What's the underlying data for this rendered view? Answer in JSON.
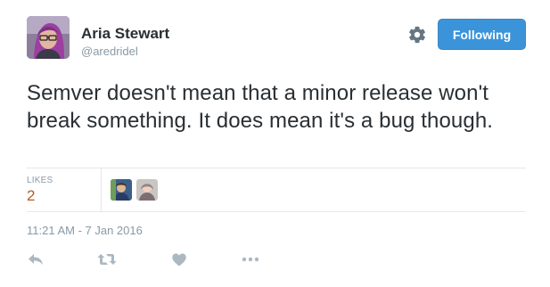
{
  "author": {
    "name": "Aria Stewart",
    "handle": "@aredridel"
  },
  "follow_button": {
    "label": "Following",
    "color": "#3b94d9"
  },
  "tweet": {
    "text": "Semver doesn't mean that a minor release won't break something. It does mean it's a bug though."
  },
  "stats": {
    "likes_label": "LIKES",
    "likes_count": "2"
  },
  "timestamp": "11:21 AM - 7 Jan 2016",
  "icons": {
    "settings": "gear-icon",
    "reply": "reply-icon",
    "retweet": "retweet-icon",
    "like": "heart-icon",
    "more": "more-icon"
  },
  "colors": {
    "muted": "#8899a6",
    "likes_count": "#b45a1d",
    "divider": "#e1e8ed",
    "text": "#292f33"
  }
}
